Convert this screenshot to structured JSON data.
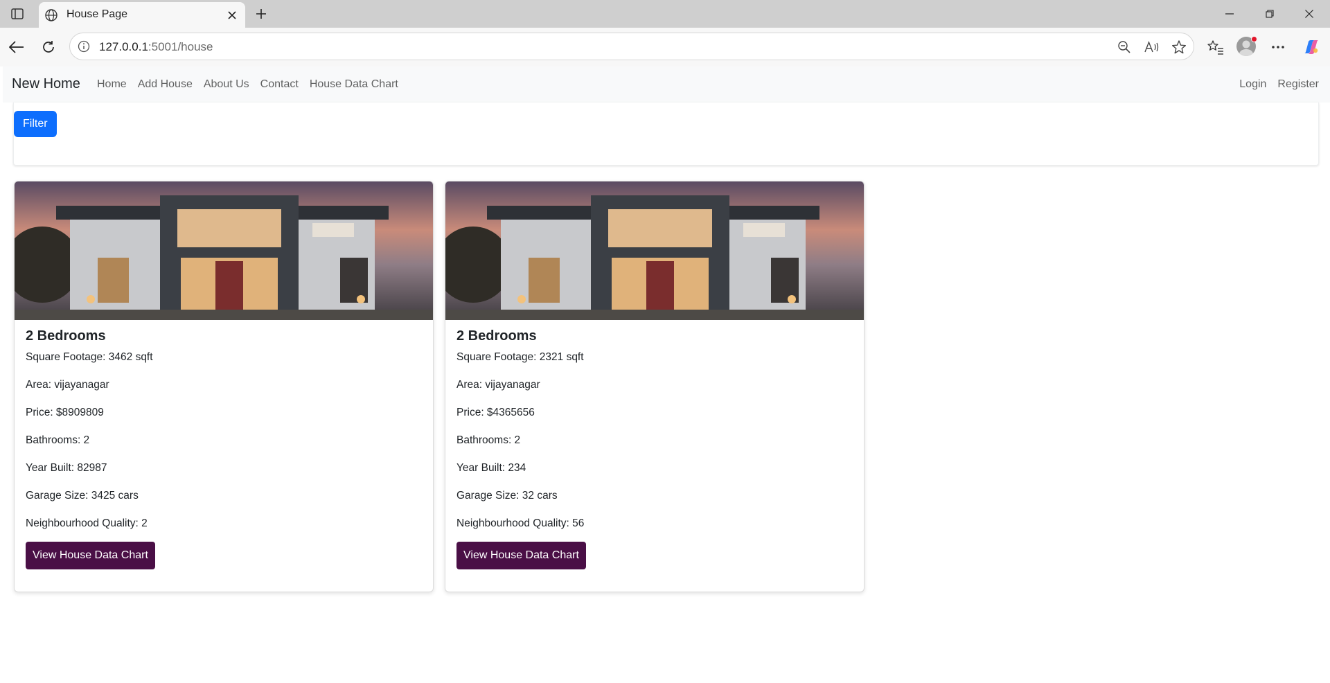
{
  "browser": {
    "tab_title": "House Page",
    "url_host": "127.0.0.1",
    "url_path": ":5001/house"
  },
  "nav": {
    "brand": "New Home",
    "links": [
      "Home",
      "Add House",
      "About Us",
      "Contact",
      "House Data Chart"
    ],
    "right_links": [
      "Login",
      "Register"
    ]
  },
  "filter": {
    "button_label": "Filter"
  },
  "houses": [
    {
      "title": "2 Bedrooms",
      "square_footage": "Square Footage: 3462 sqft",
      "area": "Area: vijayanagar",
      "price": "Price: $8909809",
      "bathrooms": "Bathrooms: 2",
      "year_built": "Year Built: 82987",
      "garage": "Garage Size: 3425 cars",
      "neighbourhood": "Neighbourhood Quality: 2",
      "button_label": "View House Data Chart"
    },
    {
      "title": "2 Bedrooms",
      "square_footage": "Square Footage: 2321 sqft",
      "area": "Area: vijayanagar",
      "price": "Price: $4365656",
      "bathrooms": "Bathrooms: 2",
      "year_built": "Year Built: 234",
      "garage": "Garage Size: 32 cars",
      "neighbourhood": "Neighbourhood Quality: 56",
      "button_label": "View House Data Chart"
    }
  ],
  "colors": {
    "primary": "#0d6efd",
    "chart_button": "#4a0f46",
    "navbar_bg": "#f8f9fa"
  }
}
